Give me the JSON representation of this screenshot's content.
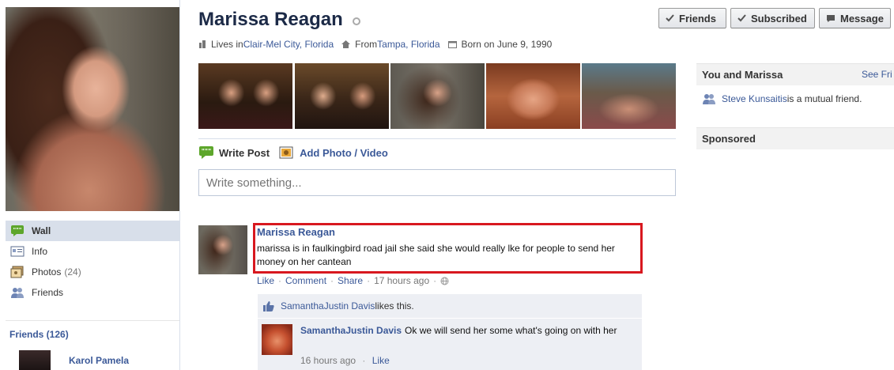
{
  "profile": {
    "name": "Marissa Reagan",
    "lives_prefix": "Lives in ",
    "lives_link": "Clair-Mel City, Florida",
    "from_prefix": "From ",
    "from_link": "Tampa, Florida",
    "born": "Born on June 9, 1990"
  },
  "header_buttons": {
    "friends": "Friends",
    "subscribed": "Subscribed",
    "message": "Message"
  },
  "sidebar": {
    "items": [
      {
        "label": "Wall"
      },
      {
        "label": "Info"
      },
      {
        "label": "Photos",
        "count": "(24)"
      },
      {
        "label": "Friends"
      }
    ],
    "friends_header": "Friends (126)",
    "friend_name": "Karol Pamela"
  },
  "composer": {
    "write_post": "Write Post",
    "add_photo": "Add Photo / Video",
    "placeholder": "Write something..."
  },
  "post": {
    "author": "Marissa Reagan",
    "body": "marissa is in faulkingbird road jail she said she would really lke for people to send her money on her cantean",
    "like": "Like",
    "comment": "Comment",
    "share": "Share",
    "time": "17 hours ago",
    "likes_name": "SamanthaJustin Davis",
    "likes_suffix": " likes this."
  },
  "comment": {
    "author": "SamanthaJustin Davis",
    "text": "Ok we will send her some what's going on with her",
    "time": "16 hours ago",
    "like": "Like"
  },
  "right": {
    "you_and": "You and Marissa",
    "see_all": "See Fri",
    "mutual_name": "Steve Kunsaitis",
    "mutual_suffix": " is a mutual friend.",
    "sponsored": "Sponsored"
  },
  "colors": {
    "link": "#3b5998",
    "highlight": "#d8181f",
    "nav_active": "#d8dfea"
  }
}
